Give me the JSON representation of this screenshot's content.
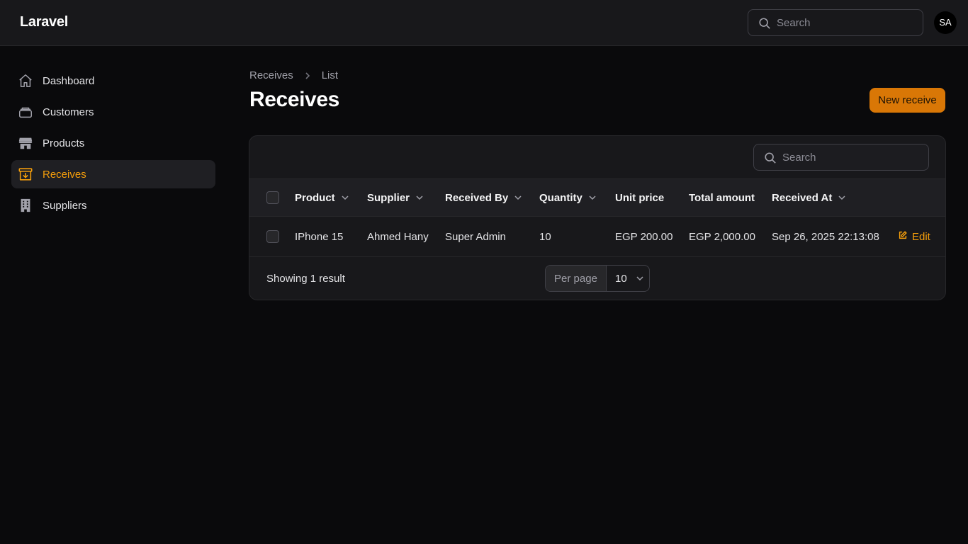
{
  "app": {
    "brand": "Laravel",
    "avatar_initials": "SA",
    "accent_color": "#f59e0b",
    "button_color": "#d97706"
  },
  "topbar": {
    "search_placeholder": "Search"
  },
  "sidebar": {
    "items": [
      {
        "label": "Dashboard",
        "icon": "home-icon",
        "active": false
      },
      {
        "label": "Customers",
        "icon": "stack-icon",
        "active": false
      },
      {
        "label": "Products",
        "icon": "storefront-icon",
        "active": false
      },
      {
        "label": "Receives",
        "icon": "archive-download-icon",
        "active": true
      },
      {
        "label": "Suppliers",
        "icon": "building-icon",
        "active": false
      }
    ]
  },
  "breadcrumb": {
    "items": [
      "Receives",
      "List"
    ]
  },
  "page": {
    "title": "Receives",
    "new_button": "New receive"
  },
  "table": {
    "search_placeholder": "Search",
    "columns": [
      "Product",
      "Supplier",
      "Received By",
      "Quantity",
      "Unit price",
      "Total amount",
      "Received At"
    ],
    "rows": [
      {
        "product": "IPhone 15",
        "supplier": "Ahmed Hany",
        "received_by": "Super Admin",
        "quantity": "10",
        "unit_price": "EGP 200.00",
        "total_amount": "EGP 2,000.00",
        "received_at": "Sep 26, 2025 22:13:08",
        "action": "Edit"
      }
    ],
    "footer": {
      "showing": "Showing 1 result",
      "per_page_label": "Per page",
      "per_page_value": "10"
    }
  }
}
